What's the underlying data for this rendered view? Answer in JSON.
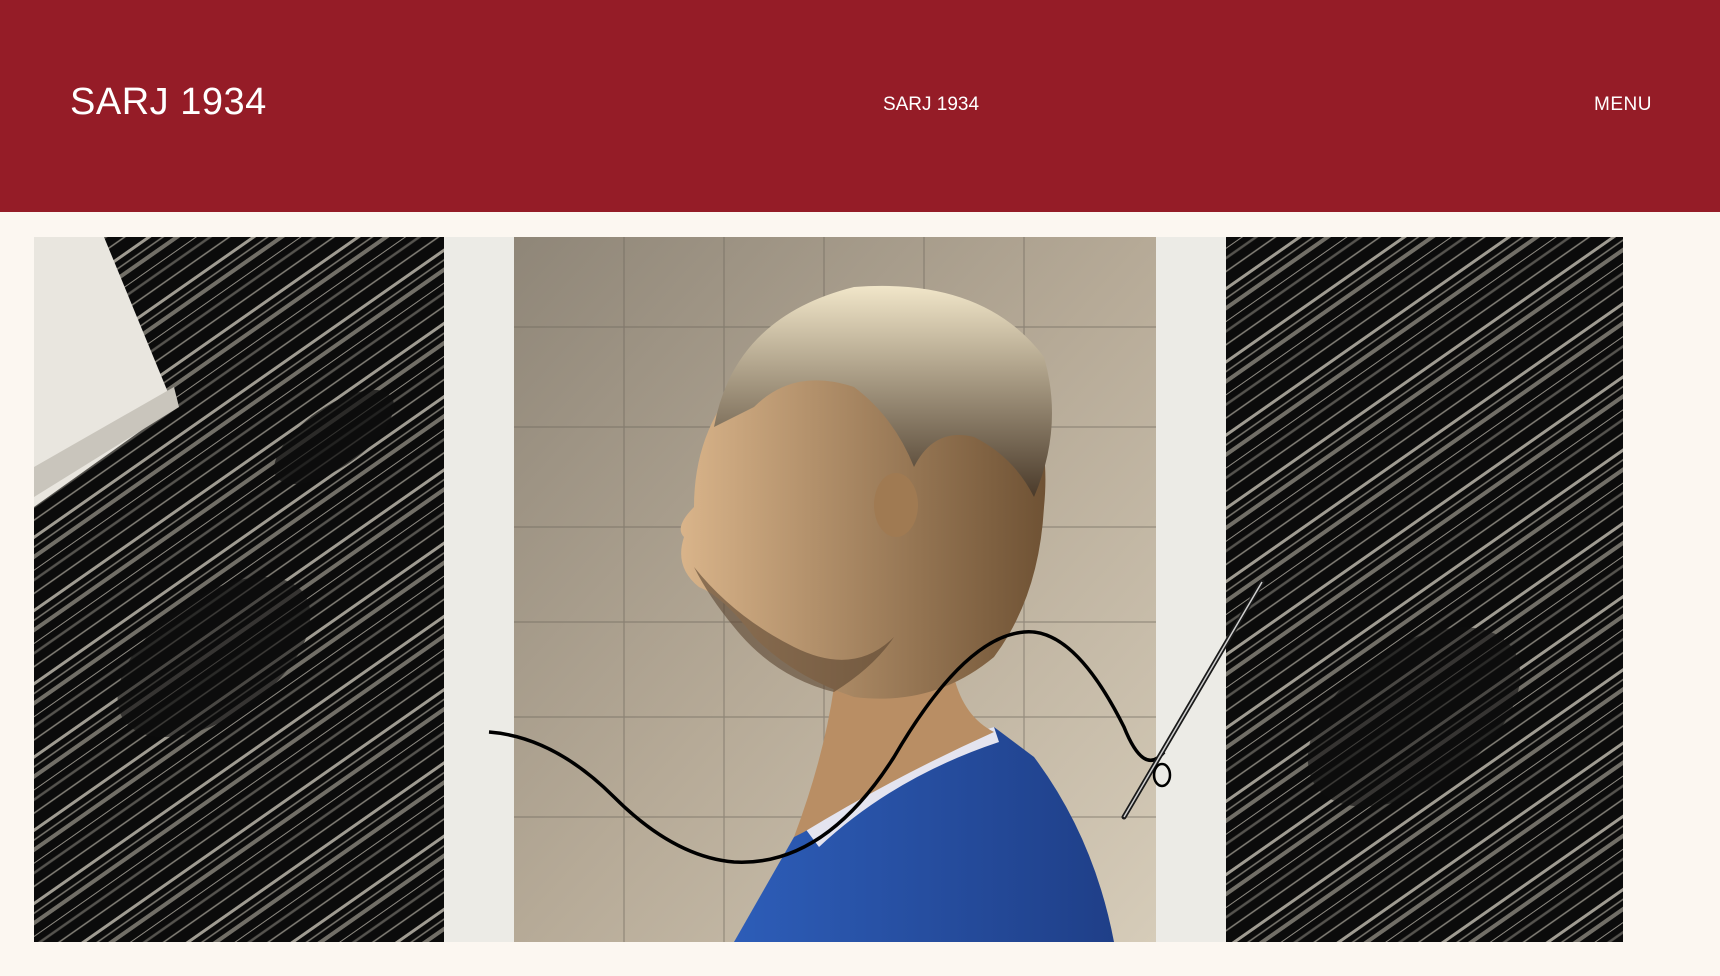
{
  "header": {
    "logo_text": "SARJ 1934",
    "center_text": "SARJ 1934",
    "menu_label": "MENU"
  },
  "hero": {
    "image_name": "woven-portrait-collage"
  },
  "colors": {
    "header_bg": "#951c27",
    "page_bg": "#fcf7f1",
    "text": "#ffffff"
  }
}
